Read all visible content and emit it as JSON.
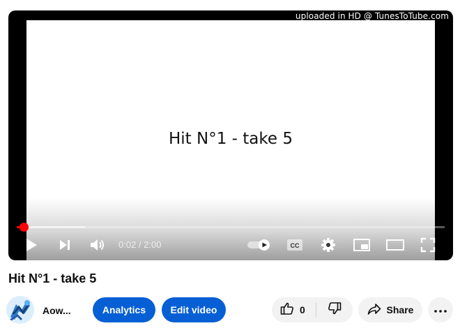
{
  "player": {
    "watermark": "uploaded in HD @ TunesToTube.com",
    "slide_title": "Hit N°1 - take 5",
    "time_display": "0:02 / 2:00",
    "progress_played_fraction": 0.017,
    "progress_loaded_fraction": 0.16,
    "controls": {
      "play_icon": "play-icon",
      "next_icon": "next-icon",
      "volume_icon": "volume-icon",
      "autoplay_icon": "autoplay-toggle-icon",
      "captions_icon": "captions-icon",
      "settings_icon": "gear-icon",
      "miniplayer_icon": "miniplayer-icon",
      "theater_icon": "theater-icon",
      "fullscreen_icon": "fullscreen-icon"
    }
  },
  "video": {
    "title": "Hit N°1 - take 5"
  },
  "channel": {
    "name": "Aow..."
  },
  "actions": {
    "analytics_label": "Analytics",
    "edit_label": "Edit video",
    "like_count": "0",
    "share_label": "Share"
  },
  "colors": {
    "accent_blue": "#065fd4",
    "progress_red": "#ff0000",
    "button_gray": "#f2f2f2"
  }
}
